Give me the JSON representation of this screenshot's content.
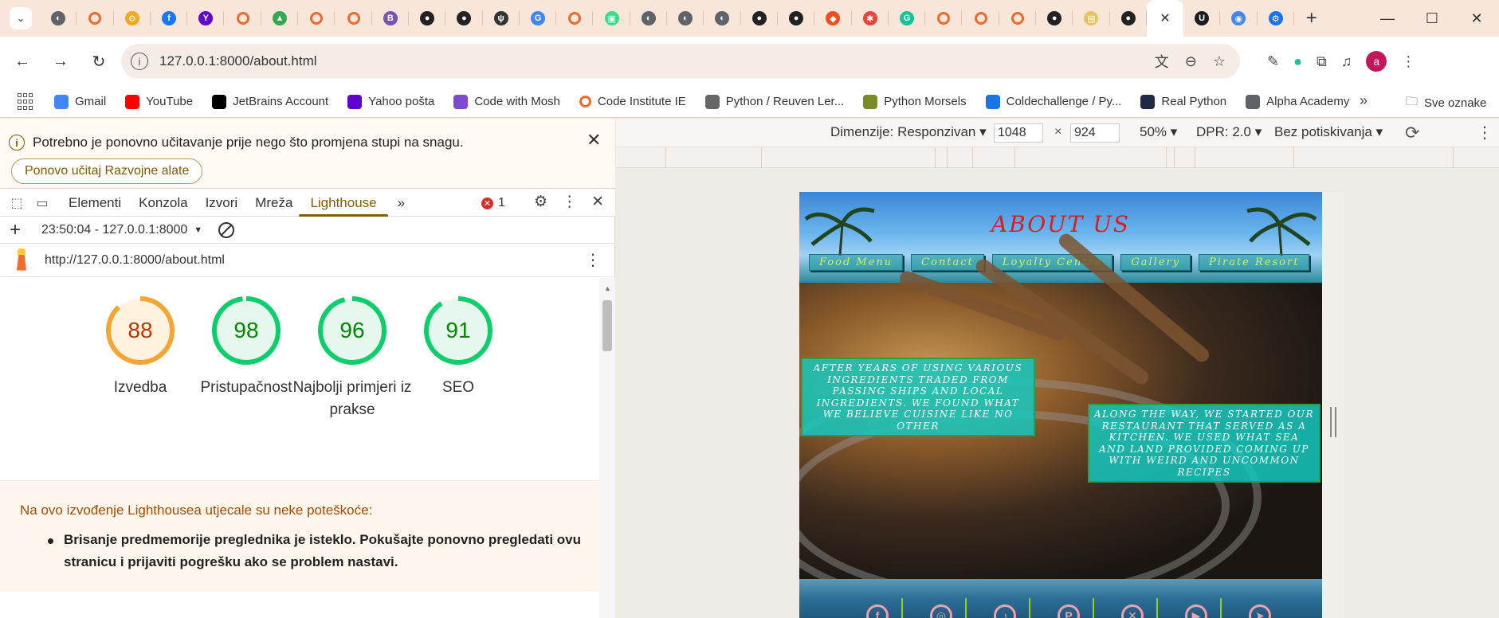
{
  "browser": {
    "tabs": [
      {
        "icon": "globe-icon",
        "color": "#5f6368"
      },
      {
        "icon": "ring-icon",
        "color": "#f06a2b"
      },
      {
        "icon": "hubspot-icon",
        "color": "#f5a623"
      },
      {
        "icon": "facebook-icon",
        "color": "#1877f2"
      },
      {
        "icon": "yahoo-icon",
        "color": "#6001d2"
      },
      {
        "icon": "ring-icon",
        "color": "#f06a2b"
      },
      {
        "icon": "drive-icon",
        "color": "#34a853"
      },
      {
        "icon": "ring-icon",
        "color": "#f06a2b"
      },
      {
        "icon": "ring-icon",
        "color": "#f06a2b"
      },
      {
        "icon": "bootstrap-icon",
        "color": "#7952b3"
      },
      {
        "icon": "github-icon",
        "color": "#222222"
      },
      {
        "icon": "github-icon",
        "color": "#222222"
      },
      {
        "icon": "fork-knife-icon",
        "color": "#333333"
      },
      {
        "icon": "google-icon",
        "color": "#4285f4"
      },
      {
        "icon": "ring-icon",
        "color": "#f06a2b"
      },
      {
        "icon": "android-icon",
        "color": "#3ddc84"
      },
      {
        "icon": "globe-icon",
        "color": "#5f6368"
      },
      {
        "icon": "globe-icon",
        "color": "#5f6368"
      },
      {
        "icon": "globe-icon",
        "color": "#5f6368"
      },
      {
        "icon": "github-icon",
        "color": "#222222"
      },
      {
        "icon": "github-icon",
        "color": "#222222"
      },
      {
        "icon": "figma-icon",
        "color": "#f24e1e"
      },
      {
        "icon": "asterisk-icon",
        "color": "#e8453c"
      },
      {
        "icon": "grammarly-icon",
        "color": "#15c39a"
      },
      {
        "icon": "ring-icon",
        "color": "#f06a2b"
      },
      {
        "icon": "ring-icon",
        "color": "#f06a2b"
      },
      {
        "icon": "ring-icon",
        "color": "#f06a2b"
      },
      {
        "icon": "github-icon",
        "color": "#222222"
      },
      {
        "icon": "scroll-icon",
        "color": "#e6c35c"
      },
      {
        "icon": "github-icon",
        "color": "#222222"
      },
      {
        "icon": "close-icon",
        "color": "#333333",
        "active": true
      },
      {
        "icon": "udemy-icon",
        "color": "#1c1d1f"
      },
      {
        "icon": "chrome-icon",
        "color": "#4285f4"
      },
      {
        "icon": "settings-icon",
        "color": "#1a73e8"
      }
    ],
    "url": "127.0.0.1:8000/about.html",
    "profile_initial": "a"
  },
  "bookmarks": [
    {
      "label": "Gmail",
      "icon": "google-icon",
      "color": "#4285f4"
    },
    {
      "label": "YouTube",
      "icon": "youtube-icon",
      "color": "#ff0000"
    },
    {
      "label": "JetBrains Account",
      "icon": "jetbrains-icon",
      "color": "#000000"
    },
    {
      "label": "Yahoo pošta",
      "icon": "yahoo-icon",
      "color": "#6001d2"
    },
    {
      "label": "Code with Mosh",
      "icon": "mosh-icon",
      "color": "#7b4bd1"
    },
    {
      "label": "Code Institute IE",
      "icon": "ring-icon",
      "color": "#f06a2b"
    },
    {
      "label": "Python / Reuven Ler...",
      "icon": "building-icon",
      "color": "#666666"
    },
    {
      "label": "Python Morsels",
      "icon": "morsels-icon",
      "color": "#7a8c2a"
    },
    {
      "label": "Coldechallenge / Py...",
      "icon": "chart-icon",
      "color": "#1a73e8"
    },
    {
      "label": "Real Python",
      "icon": "realpython-icon",
      "color": "#1f2a44"
    },
    {
      "label": "Alpha Academy",
      "icon": "globe-icon",
      "color": "#5f6368"
    }
  ],
  "bookmarks_folder": "Sve oznake",
  "devtools": {
    "notice": "Potrebno je ponovno učitavanje prije nego što promjena stupi na snagu.",
    "reload_button": "Ponovo učitaj Razvojne alate",
    "tabs": [
      "Elementi",
      "Konzola",
      "Izvori",
      "Mreža",
      "Lighthouse"
    ],
    "active_tab": "Lighthouse",
    "error_count": "1",
    "run_label": "23:50:04 - 127.0.0.1:8000",
    "report_url": "http://127.0.0.1:8000/about.html",
    "scores": [
      {
        "label": "Izvedba",
        "value": 88,
        "color": "#f4a534",
        "fill": "#fff3e0",
        "text": "#c33300"
      },
      {
        "label": "Pristupačnost",
        "value": 98,
        "color": "#0cce6b",
        "fill": "#e6f7ee",
        "text": "#008800"
      },
      {
        "label": "Najbolji primjeri iz prakse",
        "value": 96,
        "color": "#0cce6b",
        "fill": "#e6f7ee",
        "text": "#008800"
      },
      {
        "label": "SEO",
        "value": 91,
        "color": "#0cce6b",
        "fill": "#e6f7ee",
        "text": "#008800"
      }
    ],
    "warning_title": "Na ovo izvođenje Lighthousea utjecale su neke poteškoće:",
    "warning_item": "Brisanje predmemorije preglednika je isteklo. Pokušajte ponovno pregledati ovu stranicu i prijaviti pogrešku ako se problem nastavi."
  },
  "device": {
    "dimensions_label": "Dimenzije: Responzivan",
    "width": "1048",
    "height": "924",
    "zoom": "50%",
    "dpr": "DPR: 2.0",
    "throttling": "Bez potiskivanja"
  },
  "site": {
    "title": "ABOUT US",
    "nav": [
      "Food Menu",
      "Contact",
      "Loyalty Centre",
      "Gallery",
      "Pirate Resort"
    ],
    "caption_left": "After years of using various ingredients traded from passing ships and local ingredients. We found what we believe cuisine like no other",
    "caption_right": "Along the way, we started our restaurant that served as a kitchen. We used what sea and land provided coming up with weird and uncommon recipes",
    "social_icons": [
      "facebook-icon",
      "instagram-icon",
      "tiktok-icon",
      "pinterest-icon",
      "x-icon",
      "youtube-icon",
      "telegram-icon"
    ],
    "social_color": "#f0a0a8"
  }
}
